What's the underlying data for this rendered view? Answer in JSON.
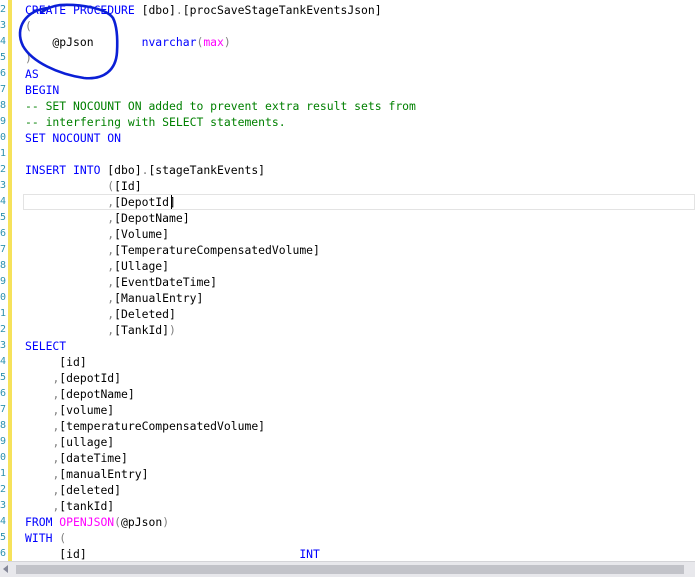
{
  "editor": {
    "line_numbers": [
      "2",
      "3",
      "4",
      "5",
      "6",
      "7",
      "8",
      "9",
      "0",
      "1",
      "2",
      "3",
      "4",
      "5",
      "6",
      "7",
      "8",
      "9",
      "0",
      "1",
      "2",
      "3",
      "4",
      "5",
      "6",
      "7",
      "8",
      "9",
      "0",
      "1",
      "2",
      "3",
      "4",
      "5",
      "6"
    ],
    "lines": [
      [
        {
          "t": "CREATE PROCEDURE ",
          "c": "kw"
        },
        {
          "t": "[dbo]",
          "c": ""
        },
        {
          "t": ".",
          "c": "gr"
        },
        {
          "t": "[procSaveStageTankEventsJson]",
          "c": ""
        }
      ],
      [
        {
          "t": "(",
          "c": "gr"
        }
      ],
      [
        {
          "t": "    @pJson       ",
          "c": ""
        },
        {
          "t": "nvarchar",
          "c": "kw"
        },
        {
          "t": "(",
          "c": "gr"
        },
        {
          "t": "max",
          "c": "fn"
        },
        {
          "t": ")",
          "c": "gr"
        }
      ],
      [
        {
          "t": ")",
          "c": "gr"
        }
      ],
      [
        {
          "t": "AS",
          "c": "kw"
        }
      ],
      [
        {
          "t": "BEGIN",
          "c": "kw"
        }
      ],
      [
        {
          "t": "-- SET NOCOUNT ON added to prevent extra result sets from",
          "c": "cm"
        }
      ],
      [
        {
          "t": "-- interfering with SELECT statements.",
          "c": "cm"
        }
      ],
      [
        {
          "t": "SET NOCOUNT ON",
          "c": "kw"
        }
      ],
      [],
      [
        {
          "t": "INSERT INTO ",
          "c": "kw"
        },
        {
          "t": "[dbo]",
          "c": ""
        },
        {
          "t": ".",
          "c": "gr"
        },
        {
          "t": "[stageTankEvents]",
          "c": ""
        }
      ],
      [
        {
          "t": "            ",
          "c": ""
        },
        {
          "t": "(",
          "c": "gr"
        },
        {
          "t": "[Id]",
          "c": ""
        }
      ],
      [
        {
          "t": "            ",
          "c": ""
        },
        {
          "t": ",",
          "c": "gr"
        },
        {
          "t": "[DepotId]",
          "c": ""
        }
      ],
      [
        {
          "t": "            ",
          "c": ""
        },
        {
          "t": ",",
          "c": "gr"
        },
        {
          "t": "[DepotName]",
          "c": ""
        }
      ],
      [
        {
          "t": "            ",
          "c": ""
        },
        {
          "t": ",",
          "c": "gr"
        },
        {
          "t": "[Volume]",
          "c": ""
        }
      ],
      [
        {
          "t": "            ",
          "c": ""
        },
        {
          "t": ",",
          "c": "gr"
        },
        {
          "t": "[TemperatureCompensatedVolume]",
          "c": ""
        }
      ],
      [
        {
          "t": "            ",
          "c": ""
        },
        {
          "t": ",",
          "c": "gr"
        },
        {
          "t": "[Ullage]",
          "c": ""
        }
      ],
      [
        {
          "t": "            ",
          "c": ""
        },
        {
          "t": ",",
          "c": "gr"
        },
        {
          "t": "[EventDateTime]",
          "c": ""
        }
      ],
      [
        {
          "t": "            ",
          "c": ""
        },
        {
          "t": ",",
          "c": "gr"
        },
        {
          "t": "[ManualEntry]",
          "c": ""
        }
      ],
      [
        {
          "t": "            ",
          "c": ""
        },
        {
          "t": ",",
          "c": "gr"
        },
        {
          "t": "[Deleted]",
          "c": ""
        }
      ],
      [
        {
          "t": "            ",
          "c": ""
        },
        {
          "t": ",",
          "c": "gr"
        },
        {
          "t": "[TankId]",
          "c": ""
        },
        {
          "t": ")",
          "c": "gr"
        }
      ],
      [
        {
          "t": "SELECT",
          "c": "kw"
        }
      ],
      [
        {
          "t": "     [id]",
          "c": ""
        }
      ],
      [
        {
          "t": "    ",
          "c": ""
        },
        {
          "t": ",",
          "c": "gr"
        },
        {
          "t": "[depotId]",
          "c": ""
        }
      ],
      [
        {
          "t": "    ",
          "c": ""
        },
        {
          "t": ",",
          "c": "gr"
        },
        {
          "t": "[depotName]",
          "c": ""
        }
      ],
      [
        {
          "t": "    ",
          "c": ""
        },
        {
          "t": ",",
          "c": "gr"
        },
        {
          "t": "[volume]",
          "c": ""
        }
      ],
      [
        {
          "t": "    ",
          "c": ""
        },
        {
          "t": ",",
          "c": "gr"
        },
        {
          "t": "[temperatureCompensatedVolume]",
          "c": ""
        }
      ],
      [
        {
          "t": "    ",
          "c": ""
        },
        {
          "t": ",",
          "c": "gr"
        },
        {
          "t": "[ullage]",
          "c": ""
        }
      ],
      [
        {
          "t": "    ",
          "c": ""
        },
        {
          "t": ",",
          "c": "gr"
        },
        {
          "t": "[dateTime]",
          "c": ""
        }
      ],
      [
        {
          "t": "    ",
          "c": ""
        },
        {
          "t": ",",
          "c": "gr"
        },
        {
          "t": "[manualEntry]",
          "c": ""
        }
      ],
      [
        {
          "t": "    ",
          "c": ""
        },
        {
          "t": ",",
          "c": "gr"
        },
        {
          "t": "[deleted]",
          "c": ""
        }
      ],
      [
        {
          "t": "    ",
          "c": ""
        },
        {
          "t": ",",
          "c": "gr"
        },
        {
          "t": "[tankId]",
          "c": ""
        }
      ],
      [
        {
          "t": "FROM ",
          "c": "kw"
        },
        {
          "t": "OPENJSON",
          "c": "fn"
        },
        {
          "t": "(",
          "c": "gr"
        },
        {
          "t": "@pJson",
          "c": ""
        },
        {
          "t": ")",
          "c": "gr"
        }
      ],
      [
        {
          "t": "WITH ",
          "c": "kw"
        },
        {
          "t": "(",
          "c": "gr"
        }
      ],
      [
        {
          "t": "     [id]                               ",
          "c": ""
        },
        {
          "t": "INT",
          "c": "kw"
        }
      ]
    ]
  },
  "colors": {
    "keyword": "#0000ff",
    "function": "#ff00ff",
    "comment": "#008000",
    "punctuation": "#808080",
    "line_number": "#2b91af",
    "annotation_ink": "#0b1fd6",
    "change_margin": "#f6e25b"
  },
  "annotation": {
    "shape": "hand-drawn-circle",
    "target": "@pJson parameter"
  }
}
